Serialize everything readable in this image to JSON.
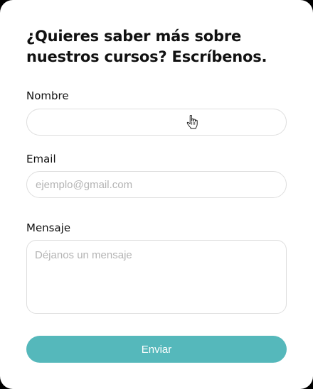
{
  "form": {
    "title": "¿Quieres saber más sobre nuestros cursos? Escríbenos.",
    "fields": {
      "nombre": {
        "label": "Nombre",
        "value": "",
        "placeholder": ""
      },
      "email": {
        "label": "Email",
        "value": "",
        "placeholder": "ejemplo@gmail.com"
      },
      "mensaje": {
        "label": "Mensaje",
        "value": "",
        "placeholder": "Déjanos un mensaje"
      }
    },
    "submit_label": "Enviar"
  },
  "colors": {
    "accent": "#55b8bb",
    "border": "#dedede",
    "placeholder": "#b4b4b4",
    "text": "#111111"
  },
  "icons": {
    "cursor": "hand-pointer-icon"
  }
}
